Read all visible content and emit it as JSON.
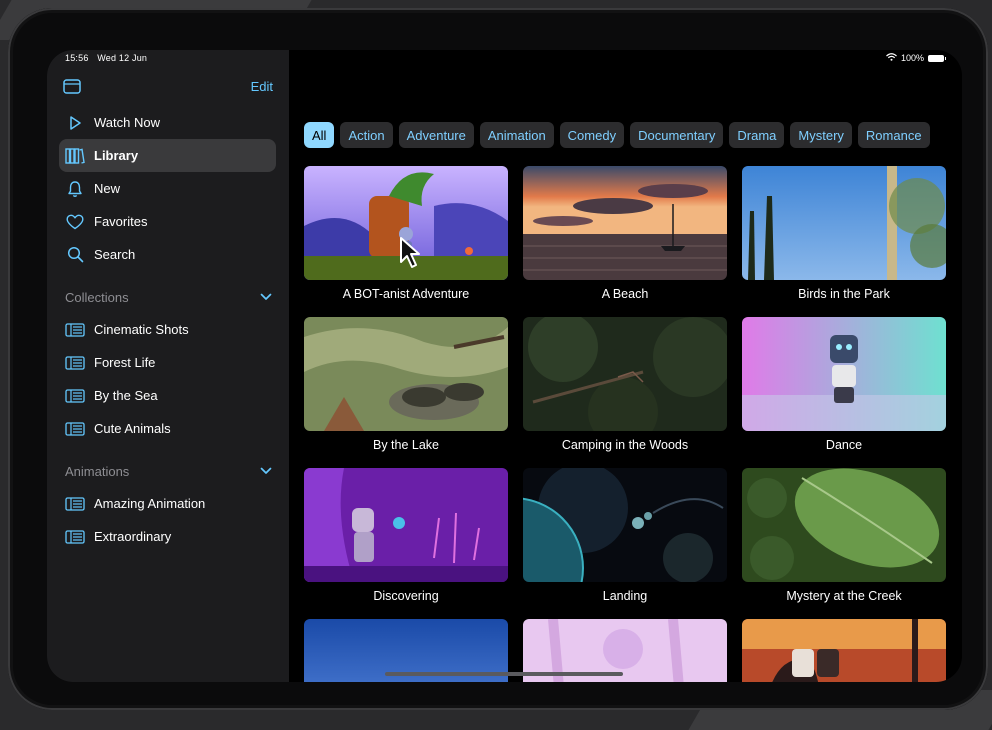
{
  "status_bar": {
    "time": "15:56",
    "date": "Wed 12 Jun",
    "battery": "100%"
  },
  "sidebar": {
    "edit_label": "Edit",
    "items": [
      {
        "label": "Watch Now",
        "icon": "play-icon",
        "selected": false
      },
      {
        "label": "Library",
        "icon": "books-icon",
        "selected": true
      },
      {
        "label": "New",
        "icon": "bell-icon",
        "selected": false
      },
      {
        "label": "Favorites",
        "icon": "heart-icon",
        "selected": false
      },
      {
        "label": "Search",
        "icon": "search-icon",
        "selected": false
      }
    ],
    "collections": {
      "title": "Collections",
      "items": [
        {
          "label": "Cinematic Shots",
          "icon": "playlist-icon"
        },
        {
          "label": "Forest Life",
          "icon": "playlist-icon"
        },
        {
          "label": "By the Sea",
          "icon": "playlist-icon"
        },
        {
          "label": "Cute Animals",
          "icon": "playlist-icon"
        }
      ]
    },
    "animations": {
      "title": "Animations",
      "items": [
        {
          "label": "Amazing Animation",
          "icon": "playlist-icon"
        },
        {
          "label": "Extraordinary",
          "icon": "playlist-icon"
        }
      ]
    }
  },
  "filters": [
    "All",
    "Action",
    "Adventure",
    "Animation",
    "Comedy",
    "Documentary",
    "Drama",
    "Mystery",
    "Romance"
  ],
  "active_filter": "All",
  "videos": [
    {
      "title": "A BOT-anist Adventure"
    },
    {
      "title": "A Beach"
    },
    {
      "title": "Birds in the Park"
    },
    {
      "title": "By the Lake"
    },
    {
      "title": "Camping in the Woods"
    },
    {
      "title": "Dance"
    },
    {
      "title": "Discovering"
    },
    {
      "title": "Landing"
    },
    {
      "title": "Mystery at the Creek"
    },
    {
      "title": ""
    },
    {
      "title": ""
    },
    {
      "title": ""
    }
  ],
  "colors": {
    "accent": "#64c8ff",
    "chip_active": "#8fd8ff",
    "sidebar_bg": "#1c1c1e",
    "selected_row": "#3a3a3c"
  }
}
